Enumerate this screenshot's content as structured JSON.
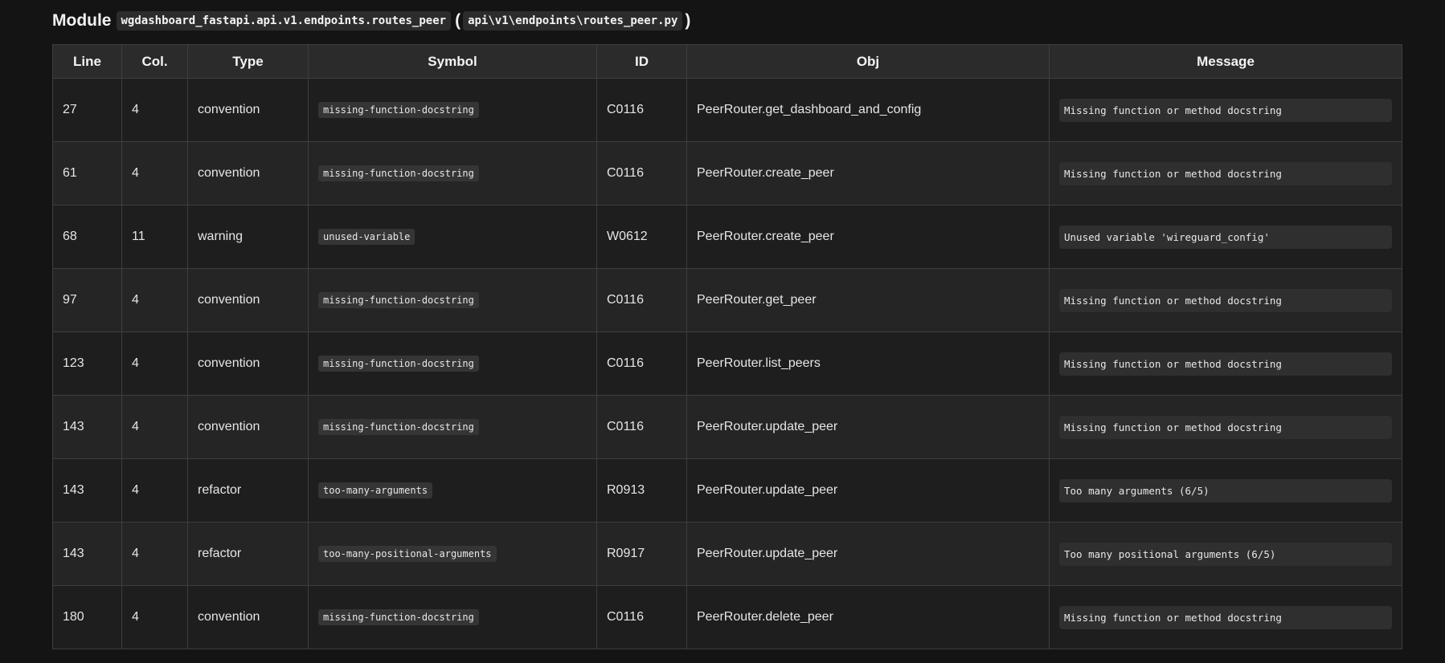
{
  "heading": {
    "prefix": "Module",
    "module_name": "wgdashboard_fastapi.api.v1.endpoints.routes_peer",
    "open_paren": "(",
    "path": "api\\v1\\endpoints\\routes_peer.py",
    "close_paren": ")"
  },
  "table": {
    "columns": [
      "Line",
      "Col.",
      "Type",
      "Symbol",
      "ID",
      "Obj",
      "Message"
    ],
    "rows": [
      {
        "line": "27",
        "col": "4",
        "type": "convention",
        "symbol": "missing-function-docstring",
        "id": "C0116",
        "obj": "PeerRouter.get_dashboard_and_config",
        "message": "Missing function or method docstring"
      },
      {
        "line": "61",
        "col": "4",
        "type": "convention",
        "symbol": "missing-function-docstring",
        "id": "C0116",
        "obj": "PeerRouter.create_peer",
        "message": "Missing function or method docstring"
      },
      {
        "line": "68",
        "col": "11",
        "type": "warning",
        "symbol": "unused-variable",
        "id": "W0612",
        "obj": "PeerRouter.create_peer",
        "message": "Unused variable 'wireguard_config'"
      },
      {
        "line": "97",
        "col": "4",
        "type": "convention",
        "symbol": "missing-function-docstring",
        "id": "C0116",
        "obj": "PeerRouter.get_peer",
        "message": "Missing function or method docstring"
      },
      {
        "line": "123",
        "col": "4",
        "type": "convention",
        "symbol": "missing-function-docstring",
        "id": "C0116",
        "obj": "PeerRouter.list_peers",
        "message": "Missing function or method docstring"
      },
      {
        "line": "143",
        "col": "4",
        "type": "convention",
        "symbol": "missing-function-docstring",
        "id": "C0116",
        "obj": "PeerRouter.update_peer",
        "message": "Missing function or method docstring"
      },
      {
        "line": "143",
        "col": "4",
        "type": "refactor",
        "symbol": "too-many-arguments",
        "id": "R0913",
        "obj": "PeerRouter.update_peer",
        "message": "Too many arguments (6/5)"
      },
      {
        "line": "143",
        "col": "4",
        "type": "refactor",
        "symbol": "too-many-positional-arguments",
        "id": "R0917",
        "obj": "PeerRouter.update_peer",
        "message": "Too many positional arguments (6/5)"
      },
      {
        "line": "180",
        "col": "4",
        "type": "convention",
        "symbol": "missing-function-docstring",
        "id": "C0116",
        "obj": "PeerRouter.delete_peer",
        "message": "Missing function or method docstring"
      }
    ]
  },
  "colors": {
    "background": "#141414",
    "type_text": "#f5c518",
    "header_bg": "#2b2b2b",
    "row_odd_bg": "#1e1e1e",
    "row_even_bg": "#252525"
  }
}
